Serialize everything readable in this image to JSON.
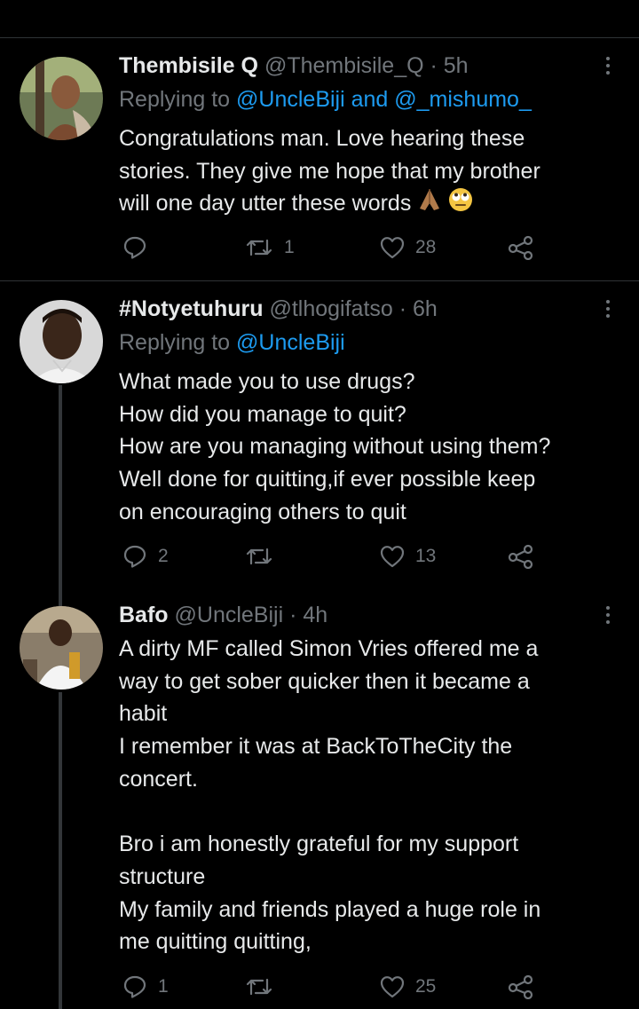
{
  "tweets": [
    {
      "name": "Thembisile Q",
      "handle": "@Thembisile_Q",
      "dot": "·",
      "time": "5h",
      "reply_prefix": "Replying to",
      "reply_mentions": "@UncleBiji and @_mishumo_",
      "text": "Congratulations man.  Love hearing these\nstories. They give me hope that my brother\nwill one day utter these words",
      "emojis": [
        "folded-hands",
        "face-with-rolling-eyes"
      ],
      "replies": "",
      "retweets": "1",
      "likes": "28"
    },
    {
      "name": "#Notyetuhuru",
      "handle": "@tlhogifatso",
      "dot": "·",
      "time": "6h",
      "reply_prefix": "Replying to",
      "reply_mentions": "@UncleBiji",
      "text": "What made you to use drugs?\nHow did you manage to quit?\nHow are you managing without using them?\nWell done for quitting,if ever possible keep\non encouraging others to quit",
      "replies": "2",
      "retweets": "",
      "likes": "13"
    },
    {
      "name": "Bafo",
      "handle": "@UncleBiji",
      "dot": "·",
      "time": "4h",
      "text": "A dirty MF called Simon Vries offered me a\nway to get sober quicker then it became a\nhabit\nI remember it was at BackToTheCity the\nconcert.\n\nBro i am honestly grateful for my support\nstructure\nMy family and friends played a huge role in\nme quitting quitting,",
      "replies": "1",
      "retweets": "",
      "likes": "25"
    }
  ],
  "icons": {
    "reply": "reply-icon",
    "retweet": "retweet-icon",
    "like": "heart-icon",
    "share": "share-icon",
    "more": "more-icon"
  },
  "colors": {
    "background": "#000000",
    "text": "#e7e9ea",
    "secondary": "#71767b",
    "mention": "#1d9bf0",
    "divider": "#2f3336"
  }
}
